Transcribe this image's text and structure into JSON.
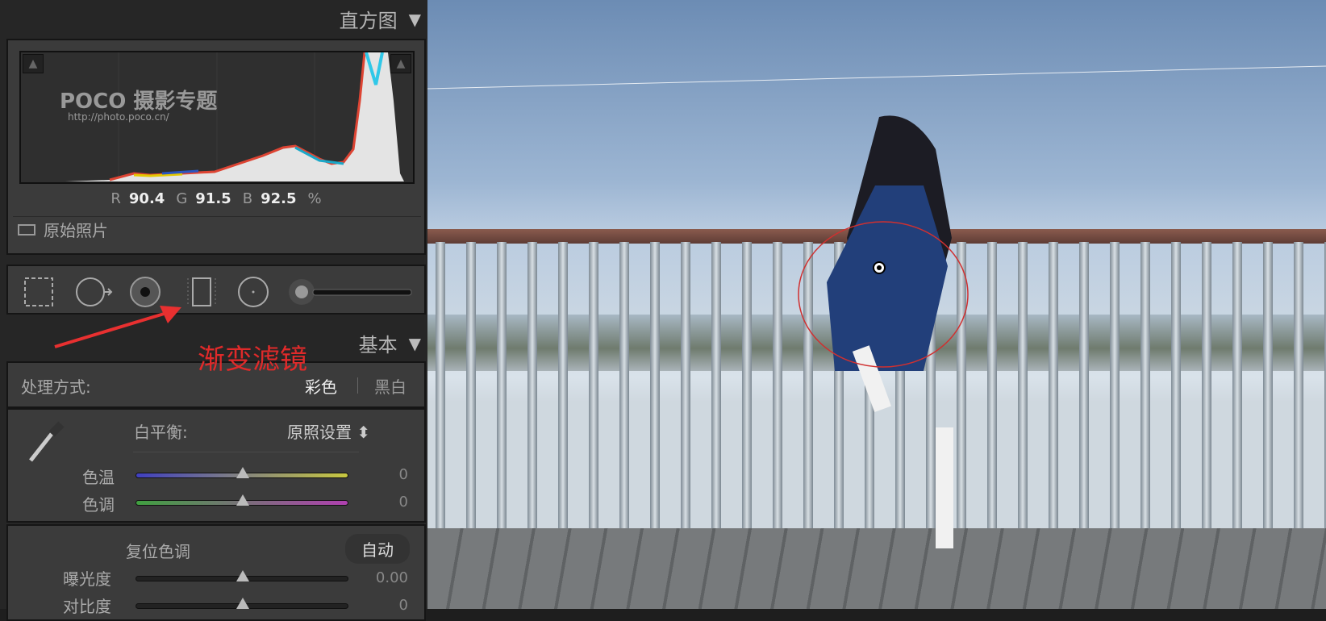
{
  "histogram": {
    "title": "直方图",
    "r_label": "R",
    "r": "90.4",
    "g_label": "G",
    "g": "91.5",
    "b_label": "B",
    "b": "92.5",
    "unit": "%",
    "original_photo": "原始照片",
    "watermark_brand": "POCO 摄影专题",
    "watermark_url": "http://photo.poco.cn/"
  },
  "tools": [
    "crop-overlay",
    "spot-removal",
    "red-eye",
    "graduated-filter",
    "radial-filter",
    "adjustment-brush"
  ],
  "annotation": "渐变滤镜",
  "basic": {
    "title": "基本",
    "treatment_label": "处理方式:",
    "color": "彩色",
    "bw": "黑白",
    "wb_label": "白平衡:",
    "wb_value": "原照设置",
    "temp_label": "色温",
    "temp_value": "0",
    "tint_label": "色调",
    "tint_value": "0",
    "reset_tone": "复位色调",
    "auto": "自动",
    "exposure_label": "曝光度",
    "exposure_value": "0.00",
    "contrast_label": "对比度",
    "contrast_value": "0"
  }
}
